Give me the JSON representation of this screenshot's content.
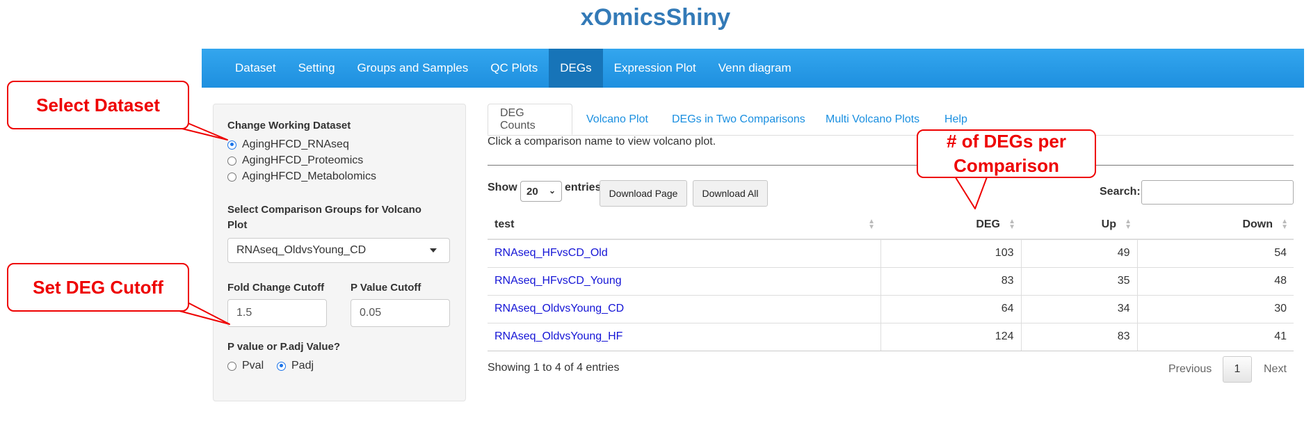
{
  "app_title": "xOmicsShiny",
  "nav": [
    "Dataset",
    "Setting",
    "Groups and Samples",
    "QC Plots",
    "DEGs",
    "Expression Plot",
    "Venn diagram"
  ],
  "nav_active": "DEGs",
  "sidebar": {
    "dataset_label": "Change Working Dataset",
    "datasets": [
      "AgingHFCD_RNAseq",
      "AgingHFCD_Proteomics",
      "AgingHFCD_Metabolomics"
    ],
    "selected_dataset": "AgingHFCD_RNAseq",
    "comparison_label_line1": "Select Comparison Groups for Volcano",
    "comparison_label_line2": "Plot",
    "comparison_value": "RNAseq_OldvsYoung_CD",
    "fc_label": "Fold Change Cutoff",
    "fc_value": "1.5",
    "p_label": "P Value Cutoff",
    "p_value": "0.05",
    "ptype_label": "P value or P.adj Value?",
    "ptype_options": [
      "Pval",
      "Padj"
    ],
    "ptype_selected": "Padj"
  },
  "callouts": {
    "select_dataset": "Select Dataset",
    "set_deg_cutoff": "Set DEG Cutoff",
    "degs_line1": "# of DEGs per",
    "degs_line2": "Comparison",
    "color": "#e00000"
  },
  "tabs": [
    "DEG Counts",
    "Volcano Plot",
    "DEGs in Two Comparisons",
    "Multi Volcano Plots",
    "Help"
  ],
  "tab_active": "DEG Counts",
  "help_text": "Click a comparison name to view volcano plot.",
  "table_controls": {
    "show_label": "Show",
    "entries_value": "20",
    "entries_label": "entries",
    "download_page": "Download Page",
    "download_all": "Download All",
    "search_label": "Search:"
  },
  "table": {
    "headers": [
      "test",
      "DEG",
      "Up",
      "Down"
    ],
    "rows": [
      [
        "RNAseq_HFvsCD_Old",
        "103",
        "49",
        "54"
      ],
      [
        "RNAseq_HFvsCD_Young",
        "83",
        "35",
        "48"
      ],
      [
        "RNAseq_OldvsYoung_CD",
        "64",
        "34",
        "30"
      ],
      [
        "RNAseq_OldvsYoung_HF",
        "124",
        "83",
        "41"
      ]
    ]
  },
  "footer": {
    "info": "Showing 1 to 4 of 4 entries",
    "previous": "Previous",
    "page": "1",
    "next": "Next"
  }
}
